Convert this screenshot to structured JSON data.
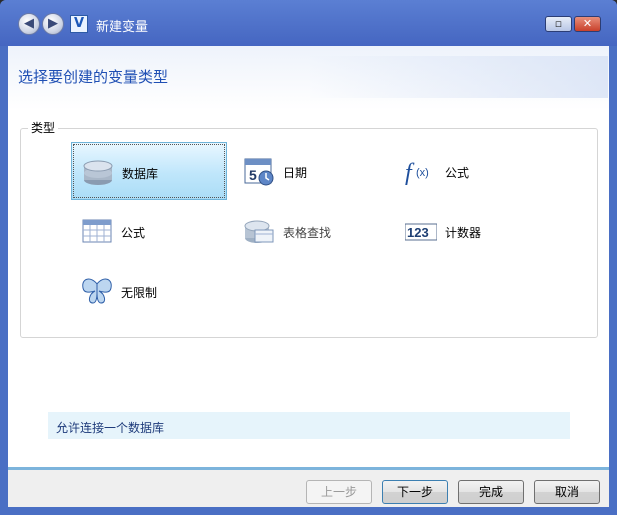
{
  "window": {
    "title": "新建变量",
    "back_icon": "back-arrow-icon",
    "forward_icon": "forward-arrow-icon",
    "app_icon": "app-logo-icon",
    "maximize_label": "▫",
    "close_label": "✕"
  },
  "header": {
    "title": "选择要创建的变量类型"
  },
  "types": {
    "group_label": "类型",
    "items": [
      {
        "label": "数据库",
        "icon": "database-icon",
        "selected": true
      },
      {
        "label": "日期",
        "icon": "calendar-icon",
        "selected": false
      },
      {
        "label": "公式",
        "icon": "function-icon",
        "selected": false
      },
      {
        "label": "公式",
        "icon": "table-icon",
        "selected": false
      },
      {
        "label": "表格查找",
        "icon": "table-lookup-icon",
        "selected": false
      },
      {
        "label": "计数器",
        "icon": "counter-icon",
        "selected": false
      },
      {
        "label": "无限制",
        "icon": "butterfly-icon",
        "selected": false
      }
    ]
  },
  "info": {
    "text": "允许连接一个数据库"
  },
  "buttons": {
    "prev": "上一步",
    "next": "下一步",
    "finish": "完成",
    "cancel": "取消"
  },
  "colors": {
    "title_bar": "#4a6fc4",
    "heading": "#1f4fb4",
    "selected_tile": "#bfe6fb",
    "info_bar": "#e6f4fb"
  }
}
